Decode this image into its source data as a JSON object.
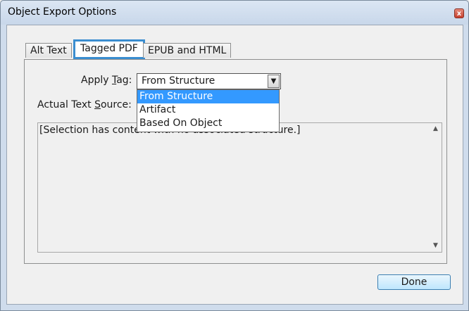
{
  "window": {
    "title": "Object Export Options",
    "close_glyph": "x"
  },
  "tabs": [
    {
      "label": "Alt Text"
    },
    {
      "label": "Tagged PDF"
    },
    {
      "label": "EPUB and HTML"
    }
  ],
  "apply_tag": {
    "label_pre": "Apply ",
    "label_access": "T",
    "label_post": "ag:",
    "value": "From Structure",
    "options": [
      "From Structure",
      "Artifact",
      "Based On Object"
    ]
  },
  "actual_text_source": {
    "label_pre": "Actual Text ",
    "label_access": "S",
    "label_post": "ource:"
  },
  "text_area": {
    "content": "[Selection has content with no associated structure.]"
  },
  "footer": {
    "done_label": "Done"
  },
  "icons": {
    "scroll_up": "scroll-up-arrow",
    "scroll_down": "scroll-down-arrow",
    "dropdown": "chevron-down-icon"
  }
}
